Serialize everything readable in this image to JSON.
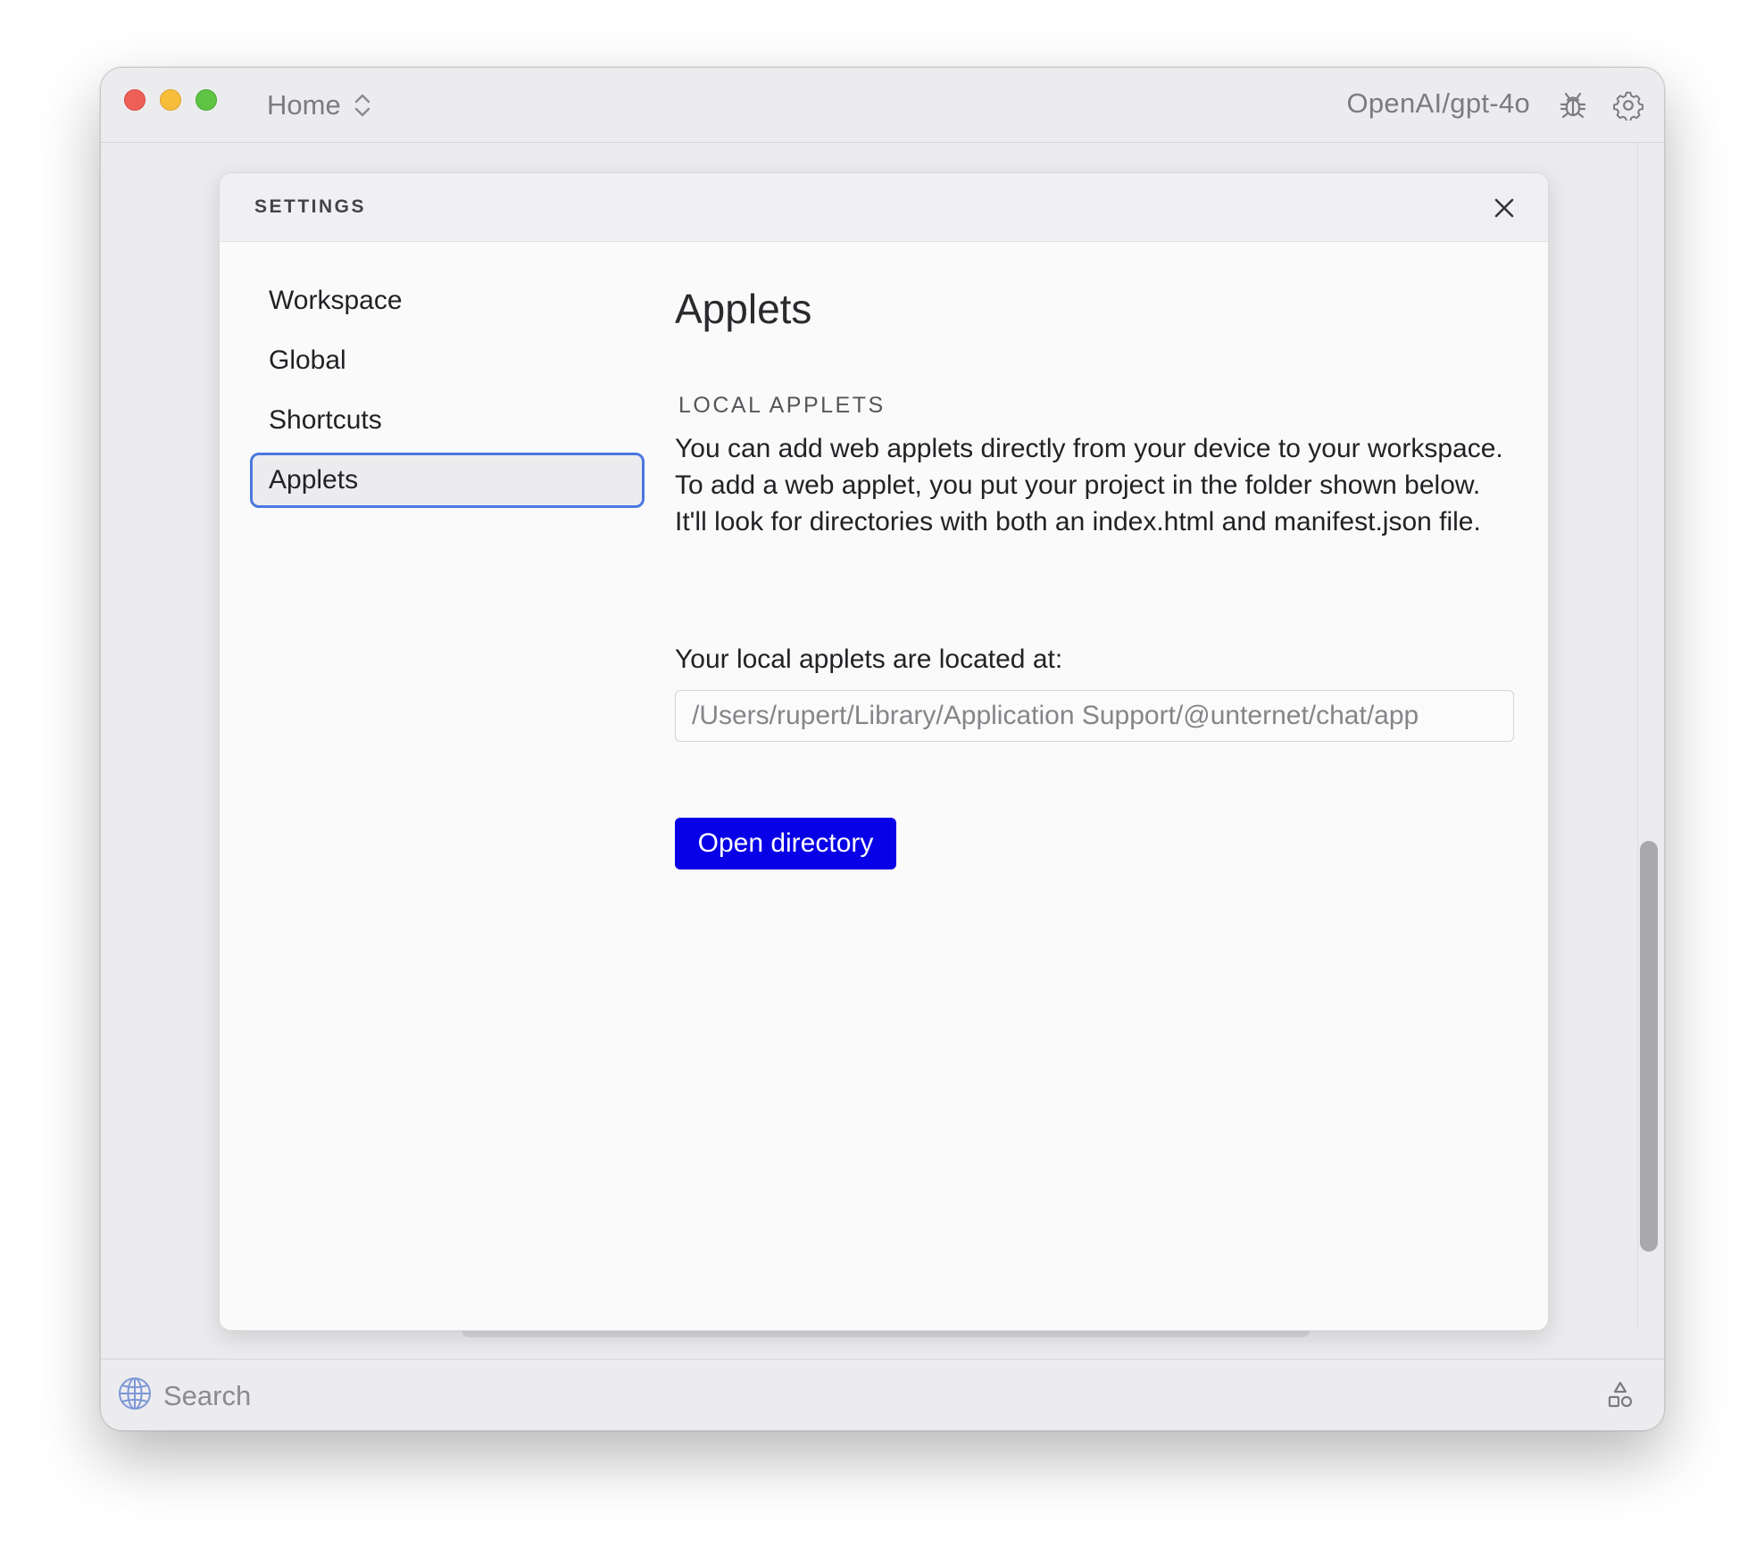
{
  "titlebar": {
    "workspace_label": "Home",
    "model_label": "OpenAI/gpt-4o",
    "icons": [
      "chevron-up-down-icon",
      "bug-icon",
      "gear-icon"
    ]
  },
  "dialog": {
    "title": "SETTINGS",
    "close_icon": "close-icon",
    "nav_items": [
      {
        "label": "Workspace",
        "active": false
      },
      {
        "label": "Global",
        "active": false
      },
      {
        "label": "Shortcuts",
        "active": false
      },
      {
        "label": "Applets",
        "active": true
      }
    ],
    "content": {
      "title": "Applets",
      "section_label": "LOCAL APPLETS",
      "description": "You can add web applets directly from your device to your workspace. To add a web applet, you put your project in the folder shown below. It'll look for directories with both an index.html and manifest.json file.",
      "location_label": "Your local applets are located at:",
      "path_value": "/Users/rupert/Library/Application Support/@unternet/chat/app",
      "open_button_label": "Open directory"
    }
  },
  "bottombar": {
    "search_placeholder": "Search",
    "icons": [
      "globe-icon",
      "shapes-icon"
    ]
  },
  "colors": {
    "accent_button": "#0800e6",
    "active_nav_border": "#4a78e0",
    "traffic_close": "#ee5f58",
    "traffic_minimize": "#f6bd3a",
    "traffic_maximize": "#5ec443"
  }
}
